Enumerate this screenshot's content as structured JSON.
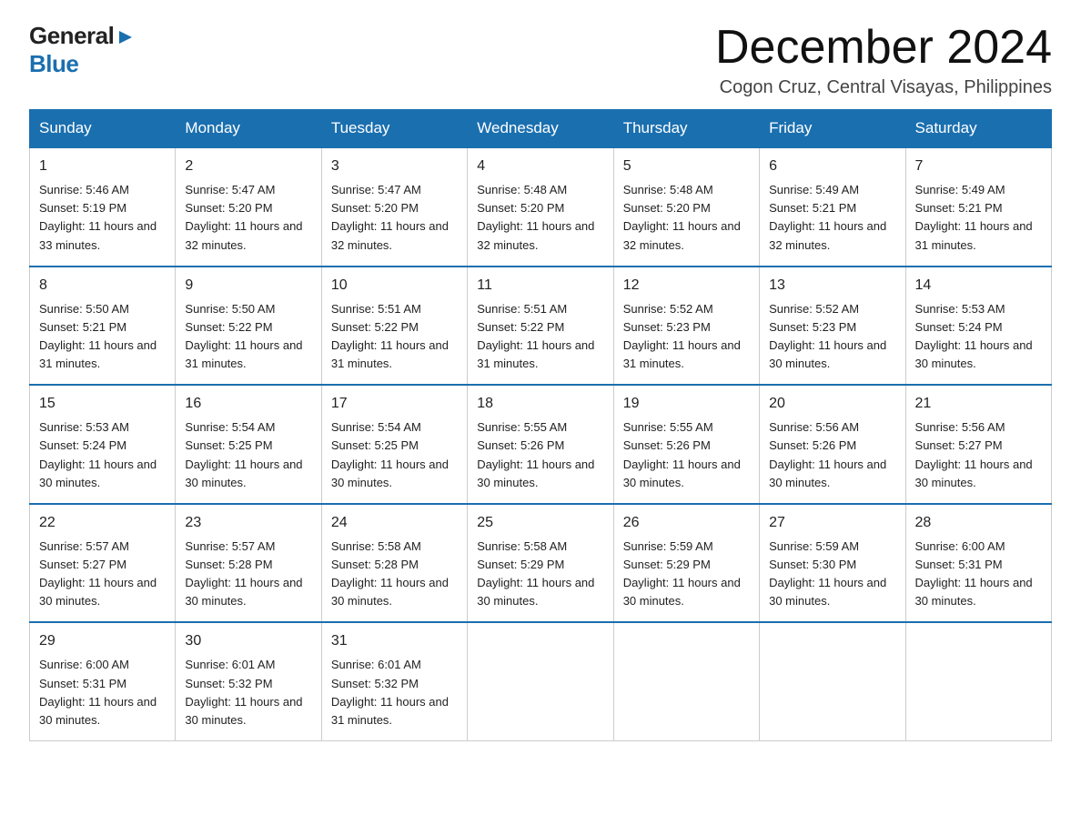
{
  "logo": {
    "general": "General",
    "blue": "Blue",
    "arrow": "▶"
  },
  "header": {
    "month_year": "December 2024",
    "location": "Cogon Cruz, Central Visayas, Philippines"
  },
  "days_of_week": [
    "Sunday",
    "Monday",
    "Tuesday",
    "Wednesday",
    "Thursday",
    "Friday",
    "Saturday"
  ],
  "weeks": [
    [
      {
        "day": "1",
        "sunrise": "Sunrise: 5:46 AM",
        "sunset": "Sunset: 5:19 PM",
        "daylight": "Daylight: 11 hours and 33 minutes."
      },
      {
        "day": "2",
        "sunrise": "Sunrise: 5:47 AM",
        "sunset": "Sunset: 5:20 PM",
        "daylight": "Daylight: 11 hours and 32 minutes."
      },
      {
        "day": "3",
        "sunrise": "Sunrise: 5:47 AM",
        "sunset": "Sunset: 5:20 PM",
        "daylight": "Daylight: 11 hours and 32 minutes."
      },
      {
        "day": "4",
        "sunrise": "Sunrise: 5:48 AM",
        "sunset": "Sunset: 5:20 PM",
        "daylight": "Daylight: 11 hours and 32 minutes."
      },
      {
        "day": "5",
        "sunrise": "Sunrise: 5:48 AM",
        "sunset": "Sunset: 5:20 PM",
        "daylight": "Daylight: 11 hours and 32 minutes."
      },
      {
        "day": "6",
        "sunrise": "Sunrise: 5:49 AM",
        "sunset": "Sunset: 5:21 PM",
        "daylight": "Daylight: 11 hours and 32 minutes."
      },
      {
        "day": "7",
        "sunrise": "Sunrise: 5:49 AM",
        "sunset": "Sunset: 5:21 PM",
        "daylight": "Daylight: 11 hours and 31 minutes."
      }
    ],
    [
      {
        "day": "8",
        "sunrise": "Sunrise: 5:50 AM",
        "sunset": "Sunset: 5:21 PM",
        "daylight": "Daylight: 11 hours and 31 minutes."
      },
      {
        "day": "9",
        "sunrise": "Sunrise: 5:50 AM",
        "sunset": "Sunset: 5:22 PM",
        "daylight": "Daylight: 11 hours and 31 minutes."
      },
      {
        "day": "10",
        "sunrise": "Sunrise: 5:51 AM",
        "sunset": "Sunset: 5:22 PM",
        "daylight": "Daylight: 11 hours and 31 minutes."
      },
      {
        "day": "11",
        "sunrise": "Sunrise: 5:51 AM",
        "sunset": "Sunset: 5:22 PM",
        "daylight": "Daylight: 11 hours and 31 minutes."
      },
      {
        "day": "12",
        "sunrise": "Sunrise: 5:52 AM",
        "sunset": "Sunset: 5:23 PM",
        "daylight": "Daylight: 11 hours and 31 minutes."
      },
      {
        "day": "13",
        "sunrise": "Sunrise: 5:52 AM",
        "sunset": "Sunset: 5:23 PM",
        "daylight": "Daylight: 11 hours and 30 minutes."
      },
      {
        "day": "14",
        "sunrise": "Sunrise: 5:53 AM",
        "sunset": "Sunset: 5:24 PM",
        "daylight": "Daylight: 11 hours and 30 minutes."
      }
    ],
    [
      {
        "day": "15",
        "sunrise": "Sunrise: 5:53 AM",
        "sunset": "Sunset: 5:24 PM",
        "daylight": "Daylight: 11 hours and 30 minutes."
      },
      {
        "day": "16",
        "sunrise": "Sunrise: 5:54 AM",
        "sunset": "Sunset: 5:25 PM",
        "daylight": "Daylight: 11 hours and 30 minutes."
      },
      {
        "day": "17",
        "sunrise": "Sunrise: 5:54 AM",
        "sunset": "Sunset: 5:25 PM",
        "daylight": "Daylight: 11 hours and 30 minutes."
      },
      {
        "day": "18",
        "sunrise": "Sunrise: 5:55 AM",
        "sunset": "Sunset: 5:26 PM",
        "daylight": "Daylight: 11 hours and 30 minutes."
      },
      {
        "day": "19",
        "sunrise": "Sunrise: 5:55 AM",
        "sunset": "Sunset: 5:26 PM",
        "daylight": "Daylight: 11 hours and 30 minutes."
      },
      {
        "day": "20",
        "sunrise": "Sunrise: 5:56 AM",
        "sunset": "Sunset: 5:26 PM",
        "daylight": "Daylight: 11 hours and 30 minutes."
      },
      {
        "day": "21",
        "sunrise": "Sunrise: 5:56 AM",
        "sunset": "Sunset: 5:27 PM",
        "daylight": "Daylight: 11 hours and 30 minutes."
      }
    ],
    [
      {
        "day": "22",
        "sunrise": "Sunrise: 5:57 AM",
        "sunset": "Sunset: 5:27 PM",
        "daylight": "Daylight: 11 hours and 30 minutes."
      },
      {
        "day": "23",
        "sunrise": "Sunrise: 5:57 AM",
        "sunset": "Sunset: 5:28 PM",
        "daylight": "Daylight: 11 hours and 30 minutes."
      },
      {
        "day": "24",
        "sunrise": "Sunrise: 5:58 AM",
        "sunset": "Sunset: 5:28 PM",
        "daylight": "Daylight: 11 hours and 30 minutes."
      },
      {
        "day": "25",
        "sunrise": "Sunrise: 5:58 AM",
        "sunset": "Sunset: 5:29 PM",
        "daylight": "Daylight: 11 hours and 30 minutes."
      },
      {
        "day": "26",
        "sunrise": "Sunrise: 5:59 AM",
        "sunset": "Sunset: 5:29 PM",
        "daylight": "Daylight: 11 hours and 30 minutes."
      },
      {
        "day": "27",
        "sunrise": "Sunrise: 5:59 AM",
        "sunset": "Sunset: 5:30 PM",
        "daylight": "Daylight: 11 hours and 30 minutes."
      },
      {
        "day": "28",
        "sunrise": "Sunrise: 6:00 AM",
        "sunset": "Sunset: 5:31 PM",
        "daylight": "Daylight: 11 hours and 30 minutes."
      }
    ],
    [
      {
        "day": "29",
        "sunrise": "Sunrise: 6:00 AM",
        "sunset": "Sunset: 5:31 PM",
        "daylight": "Daylight: 11 hours and 30 minutes."
      },
      {
        "day": "30",
        "sunrise": "Sunrise: 6:01 AM",
        "sunset": "Sunset: 5:32 PM",
        "daylight": "Daylight: 11 hours and 30 minutes."
      },
      {
        "day": "31",
        "sunrise": "Sunrise: 6:01 AM",
        "sunset": "Sunset: 5:32 PM",
        "daylight": "Daylight: 11 hours and 31 minutes."
      },
      null,
      null,
      null,
      null
    ]
  ]
}
